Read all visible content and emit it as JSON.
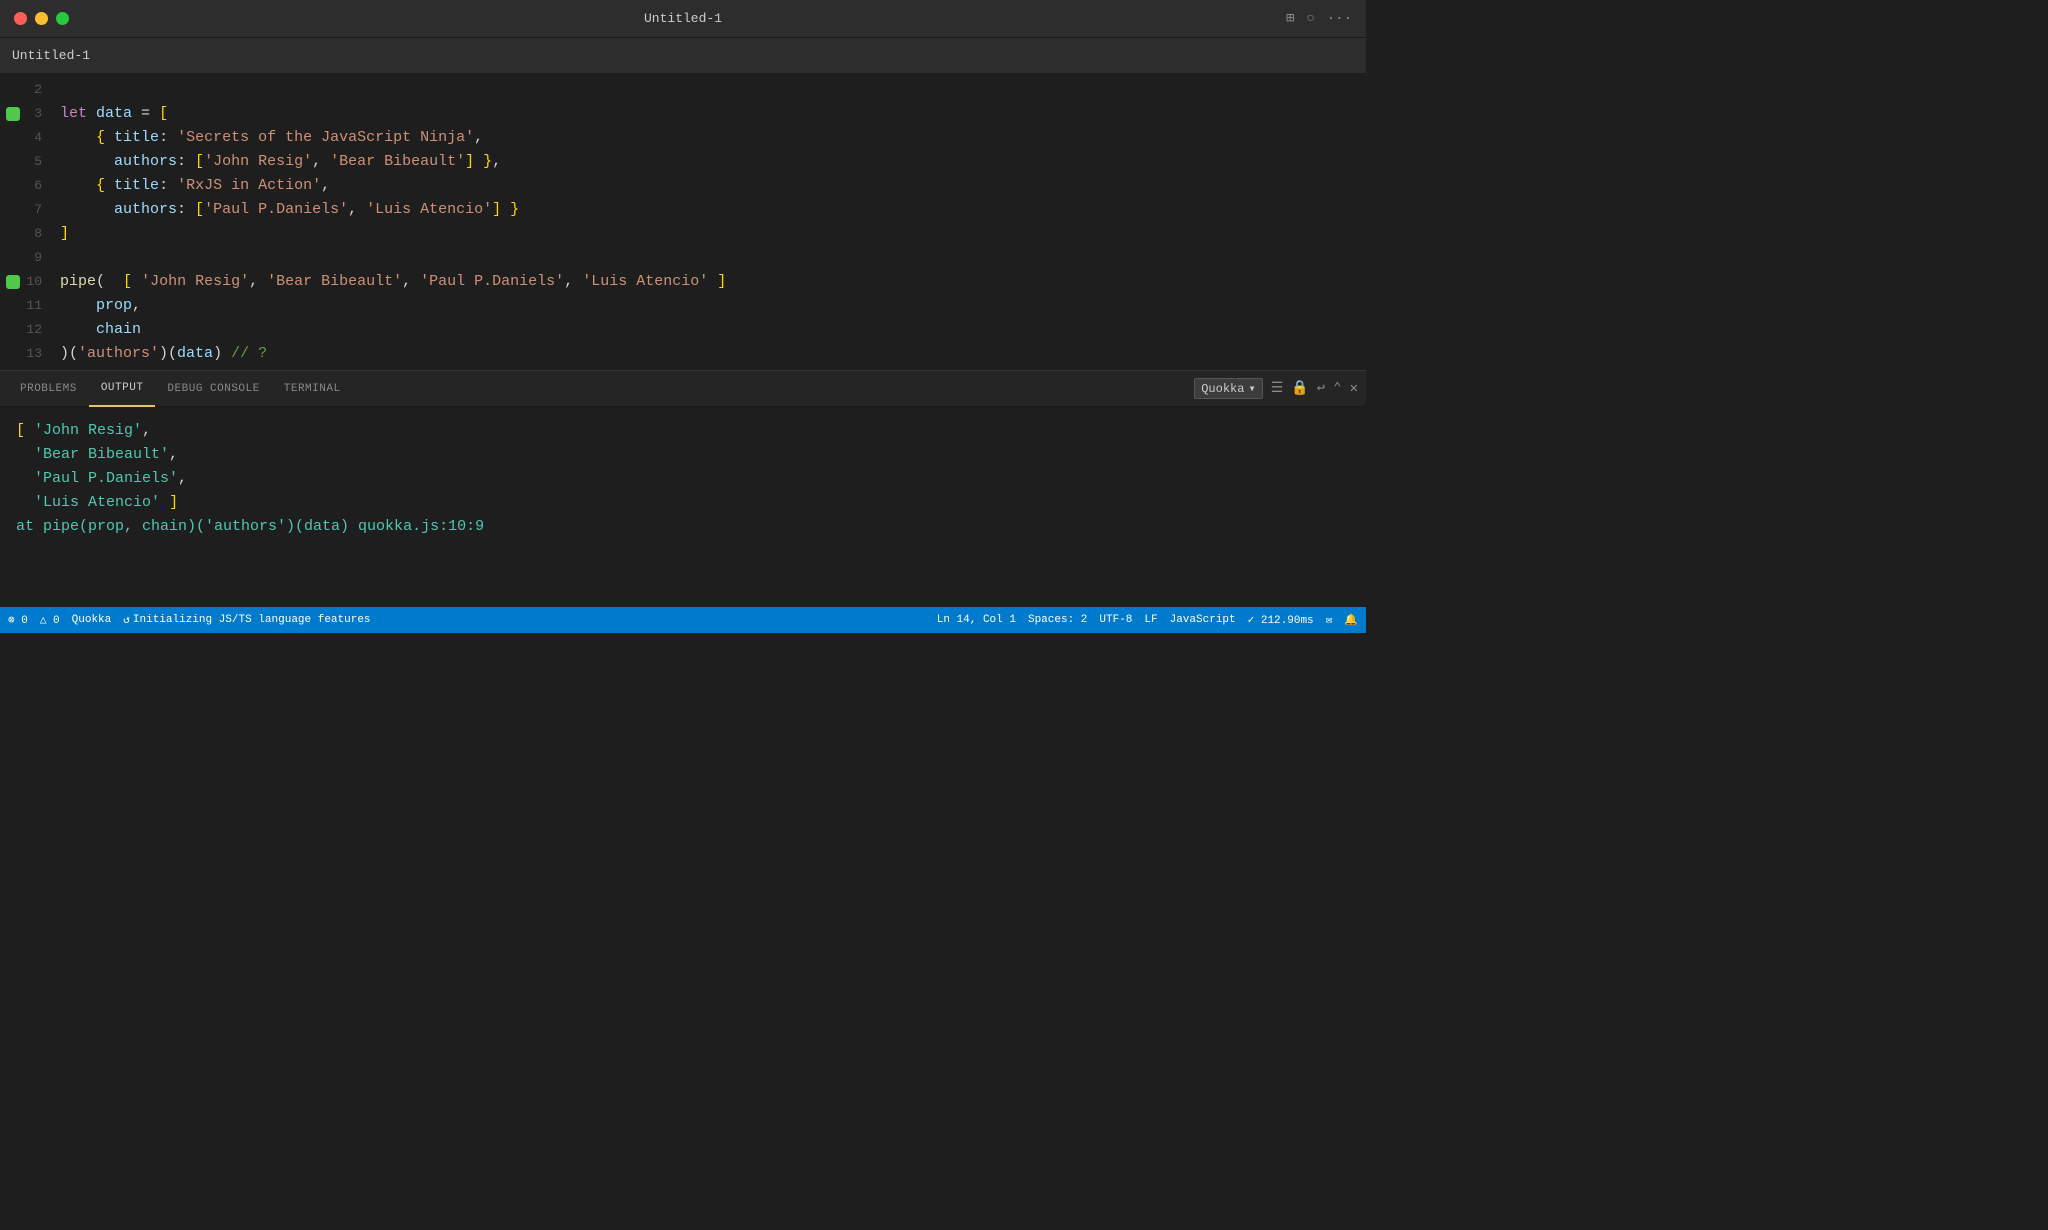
{
  "window": {
    "title": "Untitled-1",
    "tab_title": "Untitled-1"
  },
  "titlebar": {
    "close": "●",
    "minimize": "●",
    "maximize": "●"
  },
  "editor": {
    "lines": [
      {
        "num": "2",
        "dot": false,
        "content": ""
      },
      {
        "num": "3",
        "dot": true,
        "content_parts": [
          {
            "t": "kw",
            "v": "let"
          },
          {
            "t": "plain",
            "v": " "
          },
          {
            "t": "var",
            "v": "data"
          },
          {
            "t": "plain",
            "v": " = "
          },
          {
            "t": "bracket",
            "v": "["
          }
        ]
      },
      {
        "num": "4",
        "dot": false,
        "content_parts": [
          {
            "t": "plain",
            "v": "    "
          },
          {
            "t": "bracket",
            "v": "{"
          },
          {
            "t": "plain",
            "v": " "
          },
          {
            "t": "prop",
            "v": "title"
          },
          {
            "t": "plain",
            "v": ": "
          },
          {
            "t": "str",
            "v": "'Secrets of the JavaScript Ninja'"
          },
          {
            "t": "plain",
            "v": ","
          }
        ]
      },
      {
        "num": "5",
        "dot": false,
        "content_parts": [
          {
            "t": "plain",
            "v": "      "
          },
          {
            "t": "prop",
            "v": "authors"
          },
          {
            "t": "plain",
            "v": ": "
          },
          {
            "t": "bracket",
            "v": "["
          },
          {
            "t": "str",
            "v": "'John Resig'"
          },
          {
            "t": "plain",
            "v": ", "
          },
          {
            "t": "str",
            "v": "'Bear Bibeault'"
          },
          {
            "t": "bracket",
            "v": "]"
          },
          {
            "t": "plain",
            "v": " "
          },
          {
            "t": "bracket",
            "v": "}"
          },
          {
            "t": "plain",
            "v": ","
          }
        ]
      },
      {
        "num": "6",
        "dot": false,
        "content_parts": [
          {
            "t": "plain",
            "v": "    "
          },
          {
            "t": "bracket",
            "v": "{"
          },
          {
            "t": "plain",
            "v": " "
          },
          {
            "t": "prop",
            "v": "title"
          },
          {
            "t": "plain",
            "v": ": "
          },
          {
            "t": "str",
            "v": "'RxJS in Action'"
          },
          {
            "t": "plain",
            "v": ","
          }
        ]
      },
      {
        "num": "7",
        "dot": false,
        "content_parts": [
          {
            "t": "plain",
            "v": "      "
          },
          {
            "t": "prop",
            "v": "authors"
          },
          {
            "t": "plain",
            "v": ": "
          },
          {
            "t": "bracket",
            "v": "["
          },
          {
            "t": "str",
            "v": "'Paul P.Daniels'"
          },
          {
            "t": "plain",
            "v": ", "
          },
          {
            "t": "str",
            "v": "'Luis Atencio'"
          },
          {
            "t": "bracket",
            "v": "]"
          },
          {
            "t": "plain",
            "v": " "
          },
          {
            "t": "bracket",
            "v": "}"
          }
        ]
      },
      {
        "num": "8",
        "dot": false,
        "content_parts": [
          {
            "t": "bracket",
            "v": "]"
          }
        ]
      },
      {
        "num": "9",
        "dot": false,
        "content": ""
      },
      {
        "num": "10",
        "dot": true,
        "content_parts": [
          {
            "t": "fn",
            "v": "pipe"
          },
          {
            "t": "plain",
            "v": "(  "
          },
          {
            "t": "bracket",
            "v": "["
          },
          {
            "t": "plain",
            "v": " "
          },
          {
            "t": "str",
            "v": "'John Resig'"
          },
          {
            "t": "plain",
            "v": ", "
          },
          {
            "t": "str",
            "v": "'Bear Bibeault'"
          },
          {
            "t": "plain",
            "v": ", "
          },
          {
            "t": "str",
            "v": "'Paul P.Daniels'"
          },
          {
            "t": "plain",
            "v": ", "
          },
          {
            "t": "str",
            "v": "'Luis Atencio'"
          },
          {
            "t": "plain",
            "v": " "
          },
          {
            "t": "bracket",
            "v": "]"
          }
        ]
      },
      {
        "num": "11",
        "dot": false,
        "content_parts": [
          {
            "t": "plain",
            "v": "    "
          },
          {
            "t": "var",
            "v": "prop"
          },
          {
            "t": "plain",
            "v": ","
          }
        ]
      },
      {
        "num": "12",
        "dot": false,
        "content_parts": [
          {
            "t": "plain",
            "v": "    "
          },
          {
            "t": "var",
            "v": "chain"
          }
        ]
      },
      {
        "num": "13",
        "dot": false,
        "content_parts": [
          {
            "t": "plain",
            "v": ")("
          },
          {
            "t": "str",
            "v": "'authors'"
          },
          {
            "t": "plain",
            "v": ")("
          },
          {
            "t": "var",
            "v": "data"
          },
          {
            "t": "plain",
            "v": ") "
          },
          {
            "t": "comment",
            "v": "// ?"
          }
        ]
      }
    ]
  },
  "panel": {
    "tabs": [
      {
        "label": "PROBLEMS",
        "active": false
      },
      {
        "label": "OUTPUT",
        "active": true
      },
      {
        "label": "DEBUG CONSOLE",
        "active": false
      },
      {
        "label": "TERMINAL",
        "active": false
      }
    ],
    "dropdown_value": "Quokka",
    "output_lines": [
      {
        "parts": [
          {
            "t": "bracket",
            "v": "["
          },
          {
            "t": "plain",
            "v": " "
          },
          {
            "t": "str2",
            "v": "'John Resig'"
          },
          {
            "t": "plain",
            "v": ","
          }
        ]
      },
      {
        "parts": [
          {
            "t": "plain",
            "v": "  "
          },
          {
            "t": "str2",
            "v": "'Bear Bibeault'"
          },
          {
            "t": "plain",
            "v": ","
          }
        ]
      },
      {
        "parts": [
          {
            "t": "plain",
            "v": "  "
          },
          {
            "t": "str2",
            "v": "'Paul P.Daniels'"
          },
          {
            "t": "plain",
            "v": ","
          }
        ]
      },
      {
        "parts": [
          {
            "t": "plain",
            "v": "  "
          },
          {
            "t": "str2",
            "v": "'Luis Atencio'"
          },
          {
            "t": "plain",
            "v": " "
          },
          {
            "t": "bracket",
            "v": "]"
          }
        ]
      },
      {
        "parts": [
          {
            "t": "teal",
            "v": "at pipe(prop, chain)('authors')(data) quokka.js:10:9"
          }
        ]
      }
    ]
  },
  "statusbar": {
    "errors": "⊗ 0",
    "warnings": "△ 0",
    "quokka": "Quokka",
    "spinner": "↺",
    "language_status": "Initializing JS/TS language features",
    "position": "Ln 14, Col 1",
    "spaces": "Spaces: 2",
    "encoding": "UTF-8",
    "line_ending": "LF",
    "language": "JavaScript",
    "timing": "✓ 212.90ms",
    "icons_right": "🔔"
  }
}
